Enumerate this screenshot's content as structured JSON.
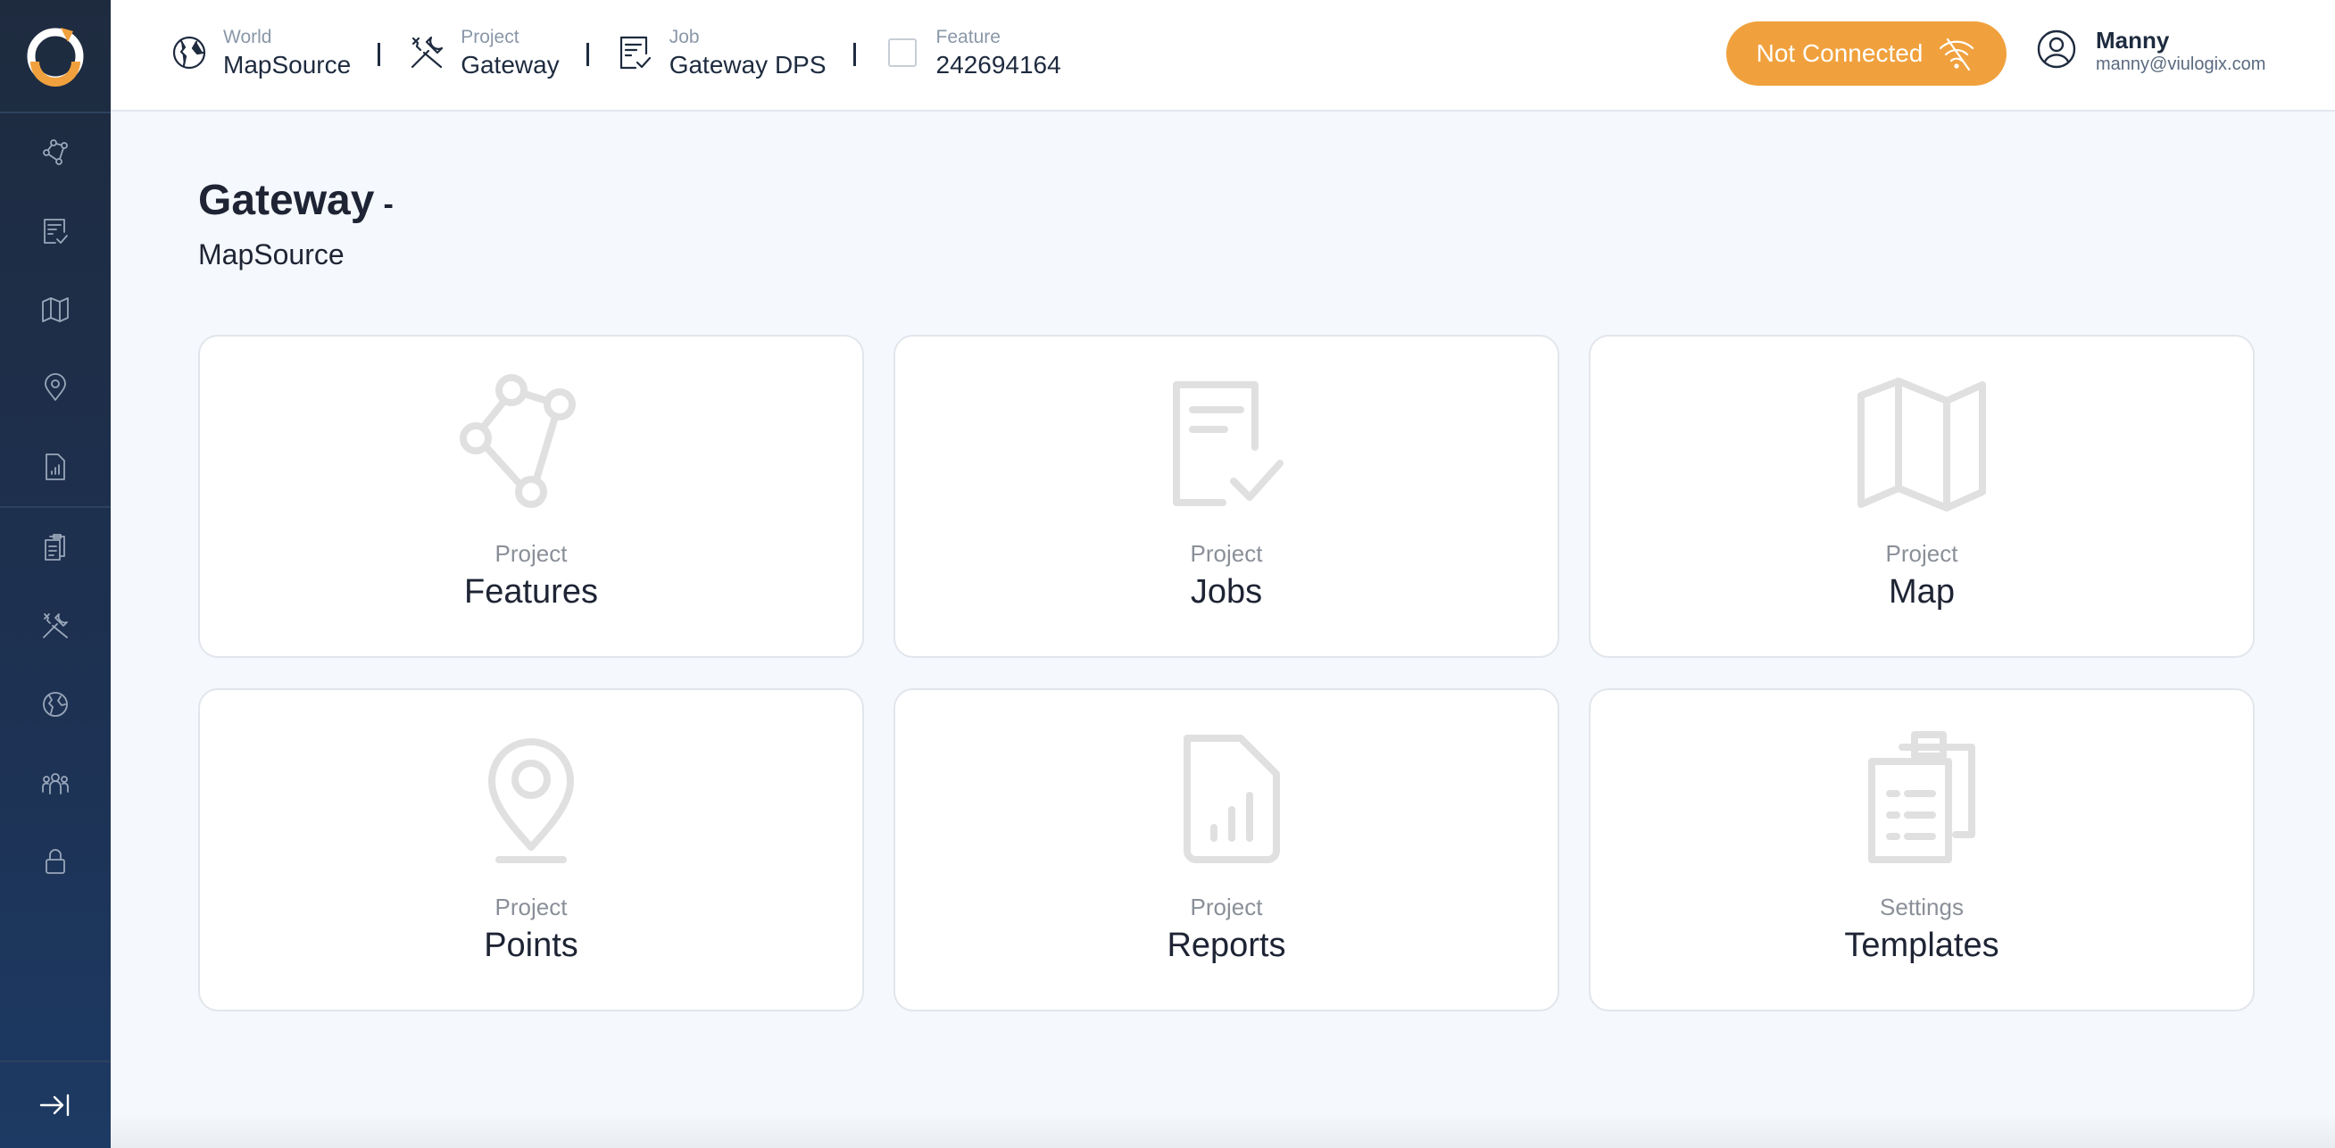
{
  "sidebar": {
    "items": [
      {
        "icon": "features-icon",
        "name": "sidebar-item-features"
      },
      {
        "icon": "jobs-icon",
        "name": "sidebar-item-jobs"
      },
      {
        "icon": "map-icon",
        "name": "sidebar-item-map"
      },
      {
        "icon": "points-icon",
        "name": "sidebar-item-points"
      },
      {
        "icon": "reports-icon",
        "name": "sidebar-item-reports"
      },
      {
        "icon": "templates-icon",
        "name": "sidebar-item-templates"
      },
      {
        "icon": "tools-icon",
        "name": "sidebar-item-projects"
      },
      {
        "icon": "globe-icon",
        "name": "sidebar-item-worlds"
      },
      {
        "icon": "users-icon",
        "name": "sidebar-item-users"
      },
      {
        "icon": "lock-icon",
        "name": "sidebar-item-security"
      }
    ],
    "collapse_icon": "collapse-arrow-icon"
  },
  "header": {
    "breadcrumbs": [
      {
        "label": "World",
        "value": "MapSource",
        "icon": "globe-icon"
      },
      {
        "label": "Project",
        "value": "Gateway",
        "icon": "tools-icon"
      },
      {
        "label": "Job",
        "value": "Gateway DPS",
        "icon": "job-icon"
      },
      {
        "label": "Feature",
        "value": "242694164",
        "icon": "checkbox-icon"
      }
    ],
    "status": {
      "label": "Not Connected",
      "icon": "wifi-off-icon",
      "color": "#f0a13d"
    },
    "user": {
      "name": "Manny",
      "email": "manny@viulogix.com",
      "icon": "user-circle-icon"
    }
  },
  "main": {
    "title": "Gateway",
    "title_dash": "-",
    "subtitle": "MapSource",
    "cards": [
      {
        "sub": "Project",
        "title": "Features",
        "icon": "features-icon"
      },
      {
        "sub": "Project",
        "title": "Jobs",
        "icon": "jobs-icon"
      },
      {
        "sub": "Project",
        "title": "Map",
        "icon": "map-icon"
      },
      {
        "sub": "Project",
        "title": "Points",
        "icon": "points-icon"
      },
      {
        "sub": "Project",
        "title": "Reports",
        "icon": "reports-icon"
      },
      {
        "sub": "Settings",
        "title": "Templates",
        "icon": "templates-icon"
      }
    ]
  },
  "colors": {
    "sidebar_bg": "#1e2b3f",
    "accent": "#f0a13d",
    "card_icon": "#e0e0e0",
    "page_bg": "#f5f8fc"
  }
}
